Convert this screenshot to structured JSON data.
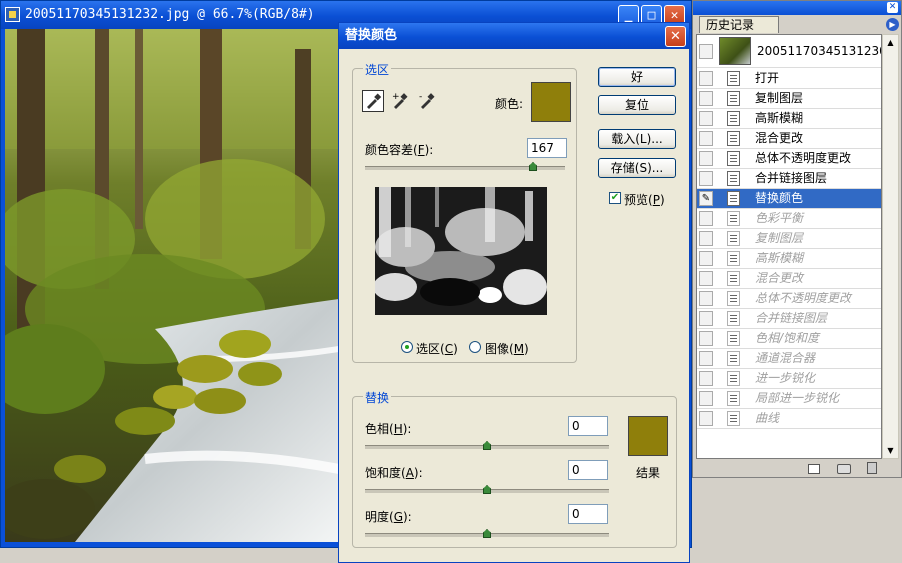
{
  "document": {
    "title": "20051170345131232.jpg @ 66.7%(RGB/8#)"
  },
  "dialog": {
    "title": "替换颜色",
    "selection_group": "选区",
    "color_label": "颜色:",
    "fuzziness_label": "颜色容差(",
    "fuzziness_key": "F",
    "fuzziness_suffix": "):",
    "fuzziness_value": "167",
    "fuzziness_fraction": 0.84,
    "radio_selection": "选区(",
    "radio_selection_key": "C",
    "radio_image": "图像(",
    "radio_image_key": "M",
    "close_paren": ")",
    "buttons": {
      "ok": "好",
      "reset": "复位",
      "load": "载入(L)...",
      "save": "存储(S)..."
    },
    "preview_label": "预览(",
    "preview_key": "P",
    "replace_group": "替换",
    "hue_label": "色相(",
    "hue_key": "H",
    "hue_value": "0",
    "saturation_label": "饱和度(",
    "saturation_key": "A",
    "saturation_value": "0",
    "lightness_label": "明度(",
    "lightness_key": "G",
    "lightness_value": "0",
    "label_suffix": "):",
    "result_label": "结果",
    "selected_color": "#8f7f0b",
    "result_color": "#8f7f0b"
  },
  "history": {
    "tab": "历史记录",
    "snapshot": "20051170345131230...",
    "items": [
      {
        "label": "打开",
        "state": "normal"
      },
      {
        "label": "复制图层",
        "state": "normal"
      },
      {
        "label": "高斯模糊",
        "state": "normal"
      },
      {
        "label": "混合更改",
        "state": "normal"
      },
      {
        "label": "总体不透明度更改",
        "state": "normal"
      },
      {
        "label": "合并链接图层",
        "state": "normal"
      },
      {
        "label": "替换颜色",
        "state": "selected"
      },
      {
        "label": "色彩平衡",
        "state": "dim"
      },
      {
        "label": "复制图层",
        "state": "dim"
      },
      {
        "label": "高斯模糊",
        "state": "dim"
      },
      {
        "label": "混合更改",
        "state": "dim"
      },
      {
        "label": "总体不透明度更改",
        "state": "dim"
      },
      {
        "label": "合并链接图层",
        "state": "dim"
      },
      {
        "label": "色相/饱和度",
        "state": "dim"
      },
      {
        "label": "通道混合器",
        "state": "dim"
      },
      {
        "label": "进一步锐化",
        "state": "dim"
      },
      {
        "label": "局部进一步锐化",
        "state": "dim"
      },
      {
        "label": "曲线",
        "state": "dim"
      }
    ]
  }
}
